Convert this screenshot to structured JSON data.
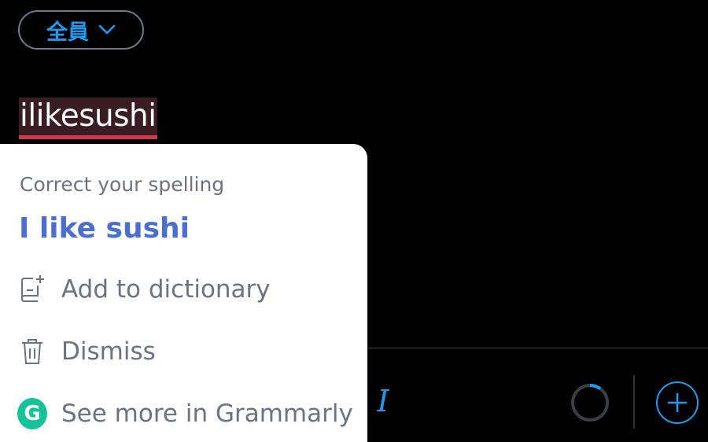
{
  "audience": {
    "label": "全員",
    "icon": "chevron-down-icon",
    "color": "#1d9bf0"
  },
  "compose": {
    "text": "ilikesushi",
    "misspelling_highlight_color": "#3a1d22",
    "underline_color": "#d4384a"
  },
  "grammarly": {
    "heading": "Correct your spelling",
    "suggestion": "I like sushi",
    "suggestion_color": "#4a6fd0",
    "actions": [
      {
        "label": "Add to dictionary",
        "icon": "dictionary-add-icon"
      },
      {
        "label": "Dismiss",
        "icon": "trash-icon"
      },
      {
        "label": "See more in Grammarly",
        "icon": "grammarly-logo-icon"
      }
    ],
    "logo_letter": "G",
    "logo_color": "#15c39a"
  },
  "toolbar": {
    "italic_label": "I",
    "icons": [
      "italic-icon",
      "character-count-ring-icon",
      "add-thread-icon"
    ],
    "accent_color": "#1d9bf0"
  }
}
